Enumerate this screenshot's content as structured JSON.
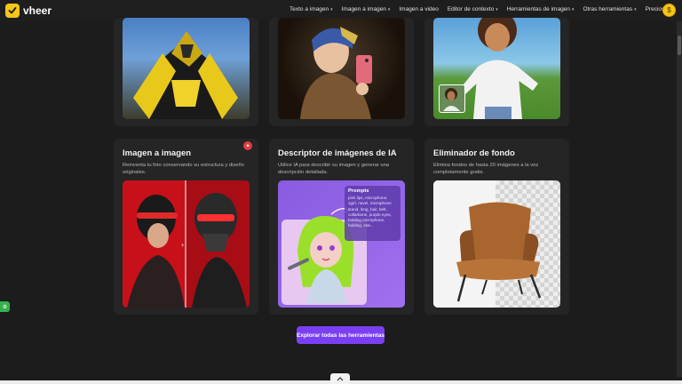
{
  "brand": {
    "name": "vheer"
  },
  "nav": {
    "items": [
      {
        "label": "Texto a imagen",
        "has_dropdown": true
      },
      {
        "label": "Imagen a imagen",
        "has_dropdown": true
      },
      {
        "label": "Imagen a video",
        "has_dropdown": false
      },
      {
        "label": "Editor de contexto",
        "has_dropdown": true
      },
      {
        "label": "Herramientas de imagen",
        "has_dropdown": true
      },
      {
        "label": "Otras herramientas",
        "has_dropdown": true
      },
      {
        "label": "Precios",
        "has_dropdown": false
      }
    ]
  },
  "cards": [
    {
      "title": "Imagen a imagen",
      "description": "Reinventa tu foto conservando su estructura y diseño originales."
    },
    {
      "title": "Descriptor de imágenes de IA",
      "description": "Utilice IA para describir su imagen y generar una descripción detallada.",
      "prompt_box": {
        "title": "Prompts",
        "text": "pink lips, microphone, 1girl, navel, microphone stand, long_hair, belt, collarbone, purple eyes, holding microphone, holding, star..."
      }
    },
    {
      "title": "Eliminador de fondo",
      "description": "Elimina fondos de hasta 20 imágenes a la vez completamente gratis."
    }
  ],
  "cta": {
    "label": "Explorar todas las herramientas"
  },
  "colors": {
    "accent": "#7b3ff2",
    "brand": "#f5c518",
    "background": "#1c1c1c",
    "card": "#252525"
  }
}
